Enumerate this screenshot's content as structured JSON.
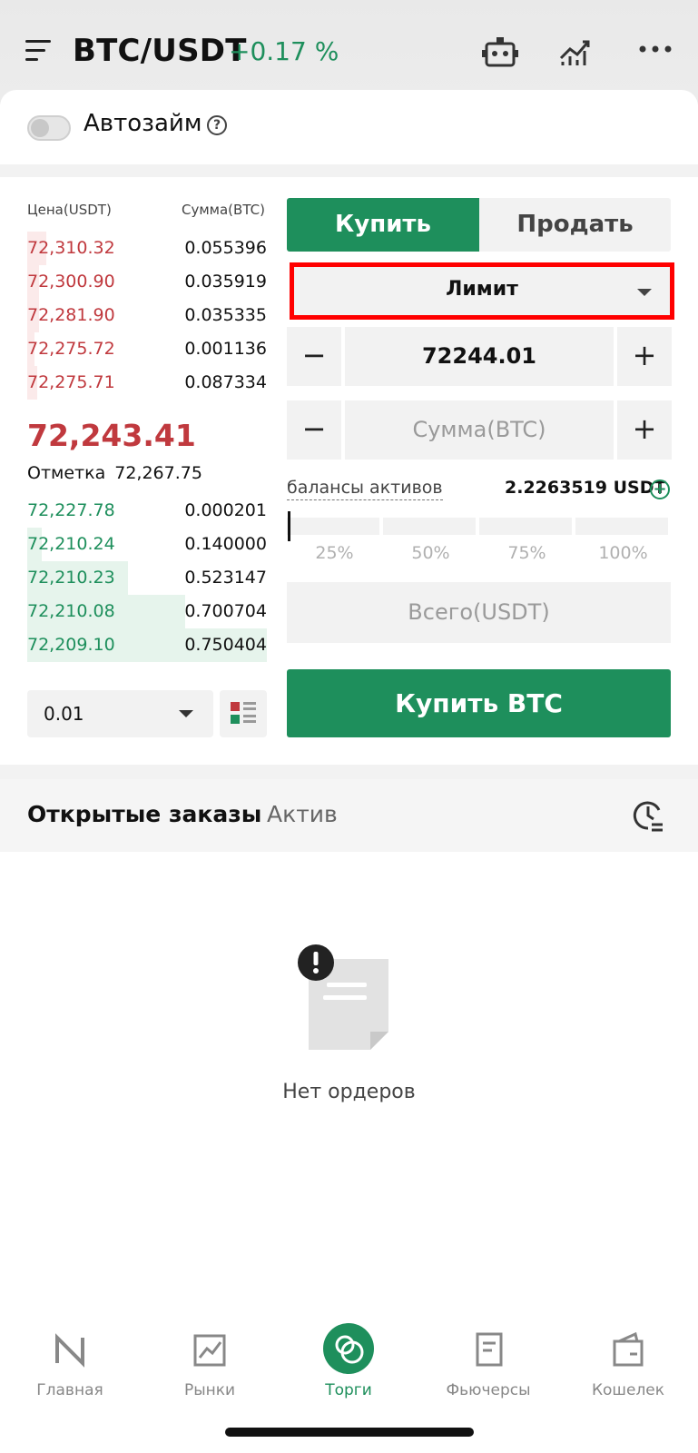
{
  "header": {
    "pair": "BTC/USDT",
    "change": "+0.17 %"
  },
  "autozaim": {
    "label": "Автозайм",
    "help": "?"
  },
  "orderbook": {
    "price_header": "Цена(USDT)",
    "amount_header": "Сумма(BTC)",
    "asks": [
      {
        "price": "72,310.32",
        "amount": "0.055396",
        "depth": 0.08
      },
      {
        "price": "72,300.90",
        "amount": "0.035919",
        "depth": 0.05
      },
      {
        "price": "72,281.90",
        "amount": "0.035335",
        "depth": 0.05
      },
      {
        "price": "72,275.72",
        "amount": "0.001136",
        "depth": 0.03
      },
      {
        "price": "72,275.71",
        "amount": "0.087334",
        "depth": 0.04
      }
    ],
    "last_price": "72,243.41",
    "mark_label": "Отметка",
    "mark_value": "72,267.75",
    "bids": [
      {
        "price": "72,227.78",
        "amount": "0.000201",
        "depth": 0.0
      },
      {
        "price": "72,210.24",
        "amount": "0.140000",
        "depth": 0.06
      },
      {
        "price": "72,210.23",
        "amount": "0.523147",
        "depth": 0.42
      },
      {
        "price": "72,210.08",
        "amount": "0.700704",
        "depth": 0.66
      },
      {
        "price": "72,209.10",
        "amount": "0.750404",
        "depth": 1.0
      }
    ],
    "depth_step": "0.01"
  },
  "form": {
    "buy_tab": "Купить",
    "sell_tab": "Продать",
    "order_type": "Лимит",
    "price_value": "72244.01",
    "amount_placeholder": "Сумма(BTC)",
    "minus": "−",
    "plus": "+",
    "balance_label": "балансы активов",
    "balance_value": "2.2263519 USDT",
    "balance_add": "+",
    "percents": [
      "25%",
      "50%",
      "75%",
      "100%"
    ],
    "slider_level": 0,
    "total_placeholder": "Всего(USDT)",
    "submit": "Купить BTC"
  },
  "orders": {
    "tab_open": "Открытые заказы",
    "tab_asset": "Актив",
    "empty_text": "Нет ордеров"
  },
  "bottom_nav": [
    {
      "label": "Главная",
      "icon": "home-logo-icon"
    },
    {
      "label": "Рынки",
      "icon": "markets-chart-icon"
    },
    {
      "label": "Торги",
      "icon": "trade-icon",
      "active": true
    },
    {
      "label": "Фьючерсы",
      "icon": "futures-doc-icon"
    },
    {
      "label": "Кошелек",
      "icon": "wallet-icon"
    }
  ],
  "colors": {
    "green": "#1e8f5c",
    "red": "#c0393e",
    "highlight": "#ff0000"
  }
}
